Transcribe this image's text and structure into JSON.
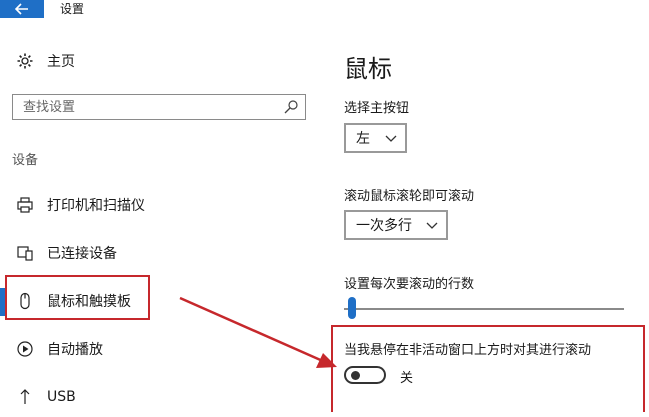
{
  "window": {
    "title": "设置",
    "back_icon": "arrow-left-icon"
  },
  "sidebar": {
    "home_label": "主页",
    "home_icon": "gear-icon",
    "search": {
      "placeholder": "查找设置",
      "icon": "search-icon"
    },
    "section_heading": "设备",
    "items": [
      {
        "label": "打印机和扫描仪",
        "icon": "printer-icon"
      },
      {
        "label": "已连接设备",
        "icon": "devices-icon"
      },
      {
        "label": "鼠标和触摸板",
        "icon": "mouse-icon",
        "selected": true
      },
      {
        "label": "自动播放",
        "icon": "autoplay-icon"
      },
      {
        "label": "USB",
        "icon": "usb-icon"
      }
    ]
  },
  "main": {
    "title": "鼠标",
    "primary_button": {
      "label": "选择主按钮",
      "value": "左"
    },
    "wheel_scroll": {
      "label": "滚动鼠标滚轮即可滚动",
      "value": "一次多行"
    },
    "lines_to_scroll": {
      "label": "设置每次要滚动的行数",
      "value": 0.03
    },
    "inactive_scroll": {
      "label": "当我悬停在非活动窗口上方时对其进行滚动",
      "state_label": "关",
      "on": false
    }
  },
  "annotation": {
    "highlight_color": "#c6282c"
  },
  "colors": {
    "accent": "#1f6fc6"
  }
}
